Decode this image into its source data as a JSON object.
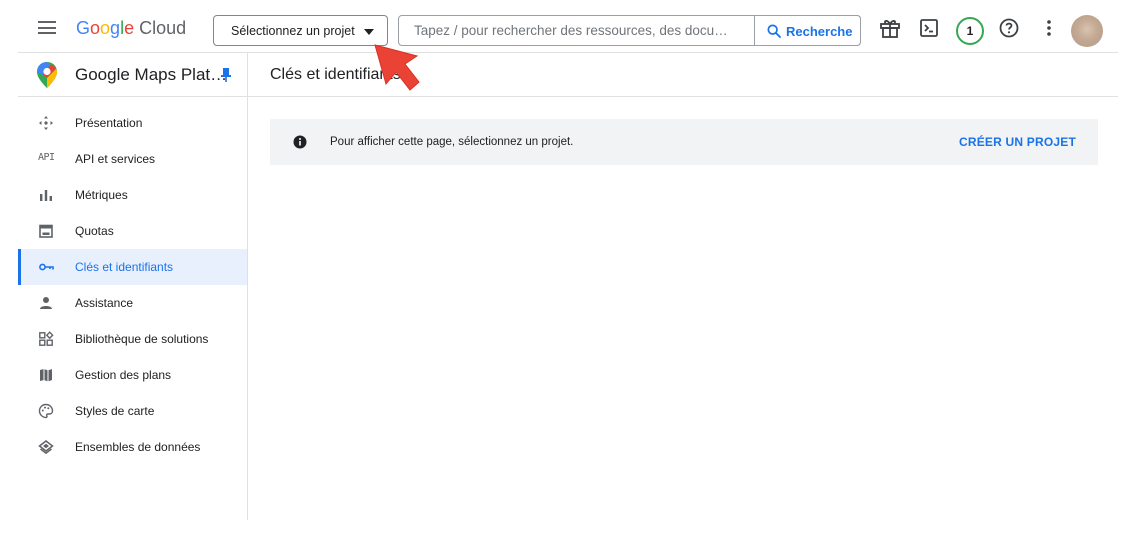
{
  "header": {
    "logo_google": "Google",
    "logo_cloud": "Cloud",
    "project_picker_label": "Sélectionnez un projet",
    "search_placeholder": "Tapez / pour rechercher des ressources, des docu…",
    "search_button_label": "Recherche",
    "notification_count": "1",
    "icons": [
      "menu-icon",
      "gift-icon",
      "terminal-icon",
      "help-icon",
      "more-vert-icon"
    ]
  },
  "sidebar": {
    "product_title": "Google Maps Plat…",
    "items": [
      {
        "label": "Présentation",
        "icon": "move-arrows-icon",
        "active": false
      },
      {
        "label": "API et services",
        "icon": "api-icon",
        "icon_text": "API",
        "active": false
      },
      {
        "label": "Métriques",
        "icon": "bar-chart-icon",
        "active": false
      },
      {
        "label": "Quotas",
        "icon": "calendar-icon",
        "active": false
      },
      {
        "label": "Clés et identifiants",
        "icon": "key-icon",
        "active": true
      },
      {
        "label": "Assistance",
        "icon": "person-icon",
        "active": false
      },
      {
        "label": "Bibliothèque de solutions",
        "icon": "grid-icon",
        "active": false
      },
      {
        "label": "Gestion des plans",
        "icon": "map-icon",
        "active": false
      },
      {
        "label": "Styles de carte",
        "icon": "palette-icon",
        "active": false
      },
      {
        "label": "Ensembles de données",
        "icon": "layers-icon",
        "active": false
      }
    ]
  },
  "main": {
    "page_title": "Clés et identifiants",
    "banner_message": "Pour afficher cette page, sélectionnez un projet.",
    "banner_action": "CRÉER UN PROJET"
  },
  "colors": {
    "accent": "#1a73e8",
    "active_bg": "#e8f0fe",
    "banner_bg": "#f1f3f4",
    "notification_ring": "#34a853",
    "cursor_arrow": "#ea4335"
  }
}
